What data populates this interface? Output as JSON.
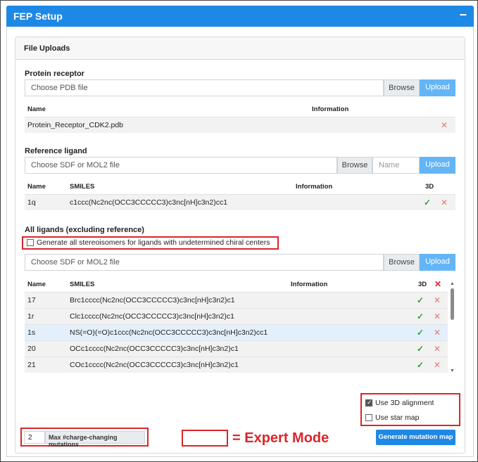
{
  "header": {
    "title": "FEP Setup",
    "collapse_icon": "−"
  },
  "file_uploads": {
    "title": "File Uploads",
    "protein": {
      "label": "Protein receptor",
      "placeholder": "Choose PDB file",
      "browse": "Browse",
      "upload": "Upload",
      "columns": [
        "Name",
        "Information"
      ],
      "rows": [
        {
          "name": "Protein_Receptor_CDK2.pdb",
          "information": ""
        }
      ]
    },
    "reference": {
      "label": "Reference ligand",
      "placeholder": "Choose SDF or MOL2 file",
      "browse": "Browse",
      "name_placeholder": "Name",
      "upload": "Upload",
      "columns": [
        "Name",
        "SMILES",
        "Information",
        "3D"
      ],
      "rows": [
        {
          "name": "1q",
          "smiles": "c1ccc(Nc2nc(OCC3CCCCC3)c3nc[nH]c3n2)cc1",
          "information": ""
        }
      ]
    },
    "all_ligands": {
      "label": "All ligands (excluding reference)",
      "stereo_option": "Generate all stereoisomers for ligands with undetermined chiral centers",
      "placeholder": "Choose SDF or MOL2 file",
      "browse": "Browse",
      "upload": "Upload",
      "columns": [
        "Name",
        "SMILES",
        "Information",
        "3D"
      ],
      "rows": [
        {
          "name": "17",
          "smiles": "Brc1cccc(Nc2nc(OCC3CCCCC3)c3nc[nH]c3n2)c1"
        },
        {
          "name": "1r",
          "smiles": "Clc1cccc(Nc2nc(OCC3CCCCC3)c3nc[nH]c3n2)c1"
        },
        {
          "name": "1s",
          "smiles": "NS(=O)(=O)c1ccc(Nc2nc(OCC3CCCCC3)c3nc[nH]c3n2)cc1"
        },
        {
          "name": "20",
          "smiles": "OCc1cccc(Nc2nc(OCC3CCCCC3)c3nc[nH]c3n2)c1"
        },
        {
          "name": "21",
          "smiles": "COc1cccc(Nc2nc(OCC3CCCCC3)c3nc[nH]c3n2)c1"
        }
      ]
    }
  },
  "options": {
    "use_3d_alignment": "Use 3D alignment",
    "use_3d_alignment_checked": true,
    "use_star_map": "Use star map",
    "use_star_map_checked": false
  },
  "max_charge": {
    "value": "2",
    "label": "Max #charge-changing mutations"
  },
  "legend": {
    "text": "= Expert Mode"
  },
  "generate_button": "Generate mutation map",
  "colors": {
    "accent": "#1e88e5",
    "upload": "#64b5f6",
    "expert": "#d9262a",
    "check": "#2e9e3c",
    "delete": "#e8776f"
  }
}
